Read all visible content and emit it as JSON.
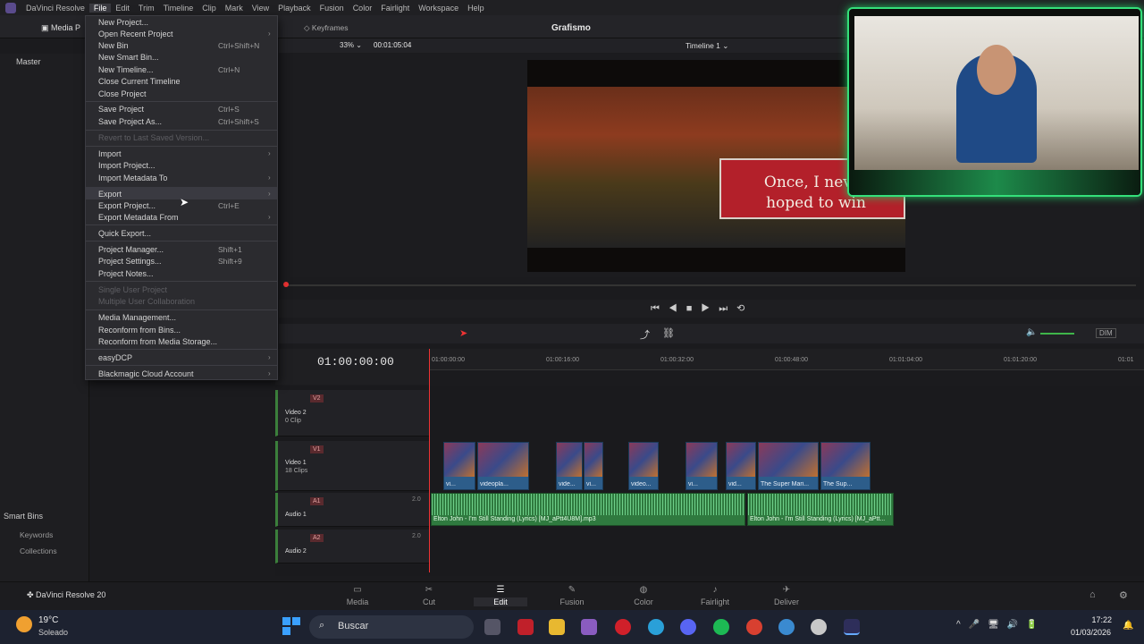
{
  "menubar": {
    "app_name": "DaVinci Resolve",
    "items": [
      "File",
      "Edit",
      "Trim",
      "Timeline",
      "Clip",
      "Mark",
      "View",
      "Playback",
      "Fusion",
      "Color",
      "Fairlight",
      "Workspace",
      "Help"
    ]
  },
  "toolbar": {
    "project_title": "Grafismo",
    "media_tab": "Media P",
    "keyframes": "Keyframes",
    "zoom": "33%",
    "timecode_viewer": "00:01:05:04",
    "timeline_name": "Timeline 1"
  },
  "left_panel": {
    "master": "Master",
    "smart_bins": "Smart Bins",
    "keywords": "Keywords",
    "collections": "Collections"
  },
  "viewer": {
    "subtitle_line1": "Once, I never",
    "subtitle_line2": "hoped to win"
  },
  "file_menu": {
    "items": [
      {
        "label": "New Project...",
        "shortcut": "",
        "arrow": false,
        "disabled": false
      },
      {
        "label": "Open Recent Project",
        "shortcut": "",
        "arrow": true,
        "disabled": false
      },
      {
        "label": "New Bin",
        "shortcut": "Ctrl+Shift+N",
        "arrow": false,
        "disabled": false
      },
      {
        "label": "New Smart Bin...",
        "shortcut": "",
        "arrow": false,
        "disabled": false
      },
      {
        "label": "New Timeline...",
        "shortcut": "Ctrl+N",
        "arrow": false,
        "disabled": false
      },
      {
        "label": "Close Current Timeline",
        "shortcut": "",
        "arrow": false,
        "disabled": false
      },
      {
        "label": "Close Project",
        "shortcut": "",
        "arrow": false,
        "disabled": false
      },
      {
        "label": "Save Project",
        "shortcut": "Ctrl+S",
        "arrow": false,
        "disabled": false
      },
      {
        "label": "Save Project As...",
        "shortcut": "Ctrl+Shift+S",
        "arrow": false,
        "disabled": false
      },
      {
        "label": "Revert to Last Saved Version...",
        "shortcut": "",
        "arrow": false,
        "disabled": true
      },
      {
        "label": "Import",
        "shortcut": "",
        "arrow": true,
        "disabled": false
      },
      {
        "label": "Import Project...",
        "shortcut": "",
        "arrow": false,
        "disabled": false
      },
      {
        "label": "Import Metadata To",
        "shortcut": "",
        "arrow": true,
        "disabled": false
      },
      {
        "label": "Export",
        "shortcut": "",
        "arrow": true,
        "disabled": false
      },
      {
        "label": "Export Project...",
        "shortcut": "Ctrl+E",
        "arrow": false,
        "disabled": false
      },
      {
        "label": "Export Metadata From",
        "shortcut": "",
        "arrow": true,
        "disabled": false
      },
      {
        "label": "Quick Export...",
        "shortcut": "",
        "arrow": false,
        "disabled": false
      },
      {
        "label": "Project Manager...",
        "shortcut": "Shift+1",
        "arrow": false,
        "disabled": false
      },
      {
        "label": "Project Settings...",
        "shortcut": "Shift+9",
        "arrow": false,
        "disabled": false
      },
      {
        "label": "Project Notes...",
        "shortcut": "",
        "arrow": false,
        "disabled": false
      },
      {
        "label": "Single User Project",
        "shortcut": "",
        "arrow": false,
        "disabled": true
      },
      {
        "label": "Multiple User Collaboration",
        "shortcut": "",
        "arrow": false,
        "disabled": true
      },
      {
        "label": "Media Management...",
        "shortcut": "",
        "arrow": false,
        "disabled": false
      },
      {
        "label": "Reconform from Bins...",
        "shortcut": "",
        "arrow": false,
        "disabled": false
      },
      {
        "label": "Reconform from Media Storage...",
        "shortcut": "",
        "arrow": false,
        "disabled": false
      },
      {
        "label": "easyDCP",
        "shortcut": "",
        "arrow": true,
        "disabled": false
      },
      {
        "label": "Blackmagic Cloud Account",
        "shortcut": "",
        "arrow": true,
        "disabled": false
      }
    ]
  },
  "timeline": {
    "timecode": "01:00:00:00",
    "ruler": [
      "01:00:00:00",
      "01:00:16:00",
      "01:00:32:00",
      "01:00:48:00",
      "01:01:04:00",
      "01:01:20:00",
      "01:01"
    ],
    "dim": "DIM",
    "tracks": [
      {
        "tag": "V2",
        "name": "Video 2",
        "sub": "0 Clip"
      },
      {
        "tag": "V1",
        "name": "Video 1",
        "sub": "18 Clips"
      },
      {
        "tag": "A1",
        "name": "Audio 1",
        "sub": "",
        "level": "2.0"
      },
      {
        "tag": "A2",
        "name": "Audio 2",
        "sub": "",
        "level": "2.0"
      }
    ],
    "video_clip_labels": [
      "vi...",
      "videopla...",
      "vide...",
      "vi...",
      "video...",
      "vi...",
      "vid...",
      "The Super Mari...",
      "The Sup..."
    ],
    "audio_clip_labels": [
      "Elton John - I'm Still Standing (Lyrics) [MJ_aPtt4U8M].mp3",
      "Elton John - I'm Still Standing (Lyrics) [MJ_aPtt..."
    ]
  },
  "pages": {
    "brand": "DaVinci Resolve 20",
    "items": [
      "Media",
      "Cut",
      "Edit",
      "Fusion",
      "Color",
      "Fairlight",
      "Deliver"
    ],
    "active": "Edit"
  },
  "taskbar": {
    "weather_temp": "19°C",
    "weather_text": "Soleado",
    "search_placeholder": "Buscar",
    "time": "17:22",
    "date": "01/03/2026"
  }
}
